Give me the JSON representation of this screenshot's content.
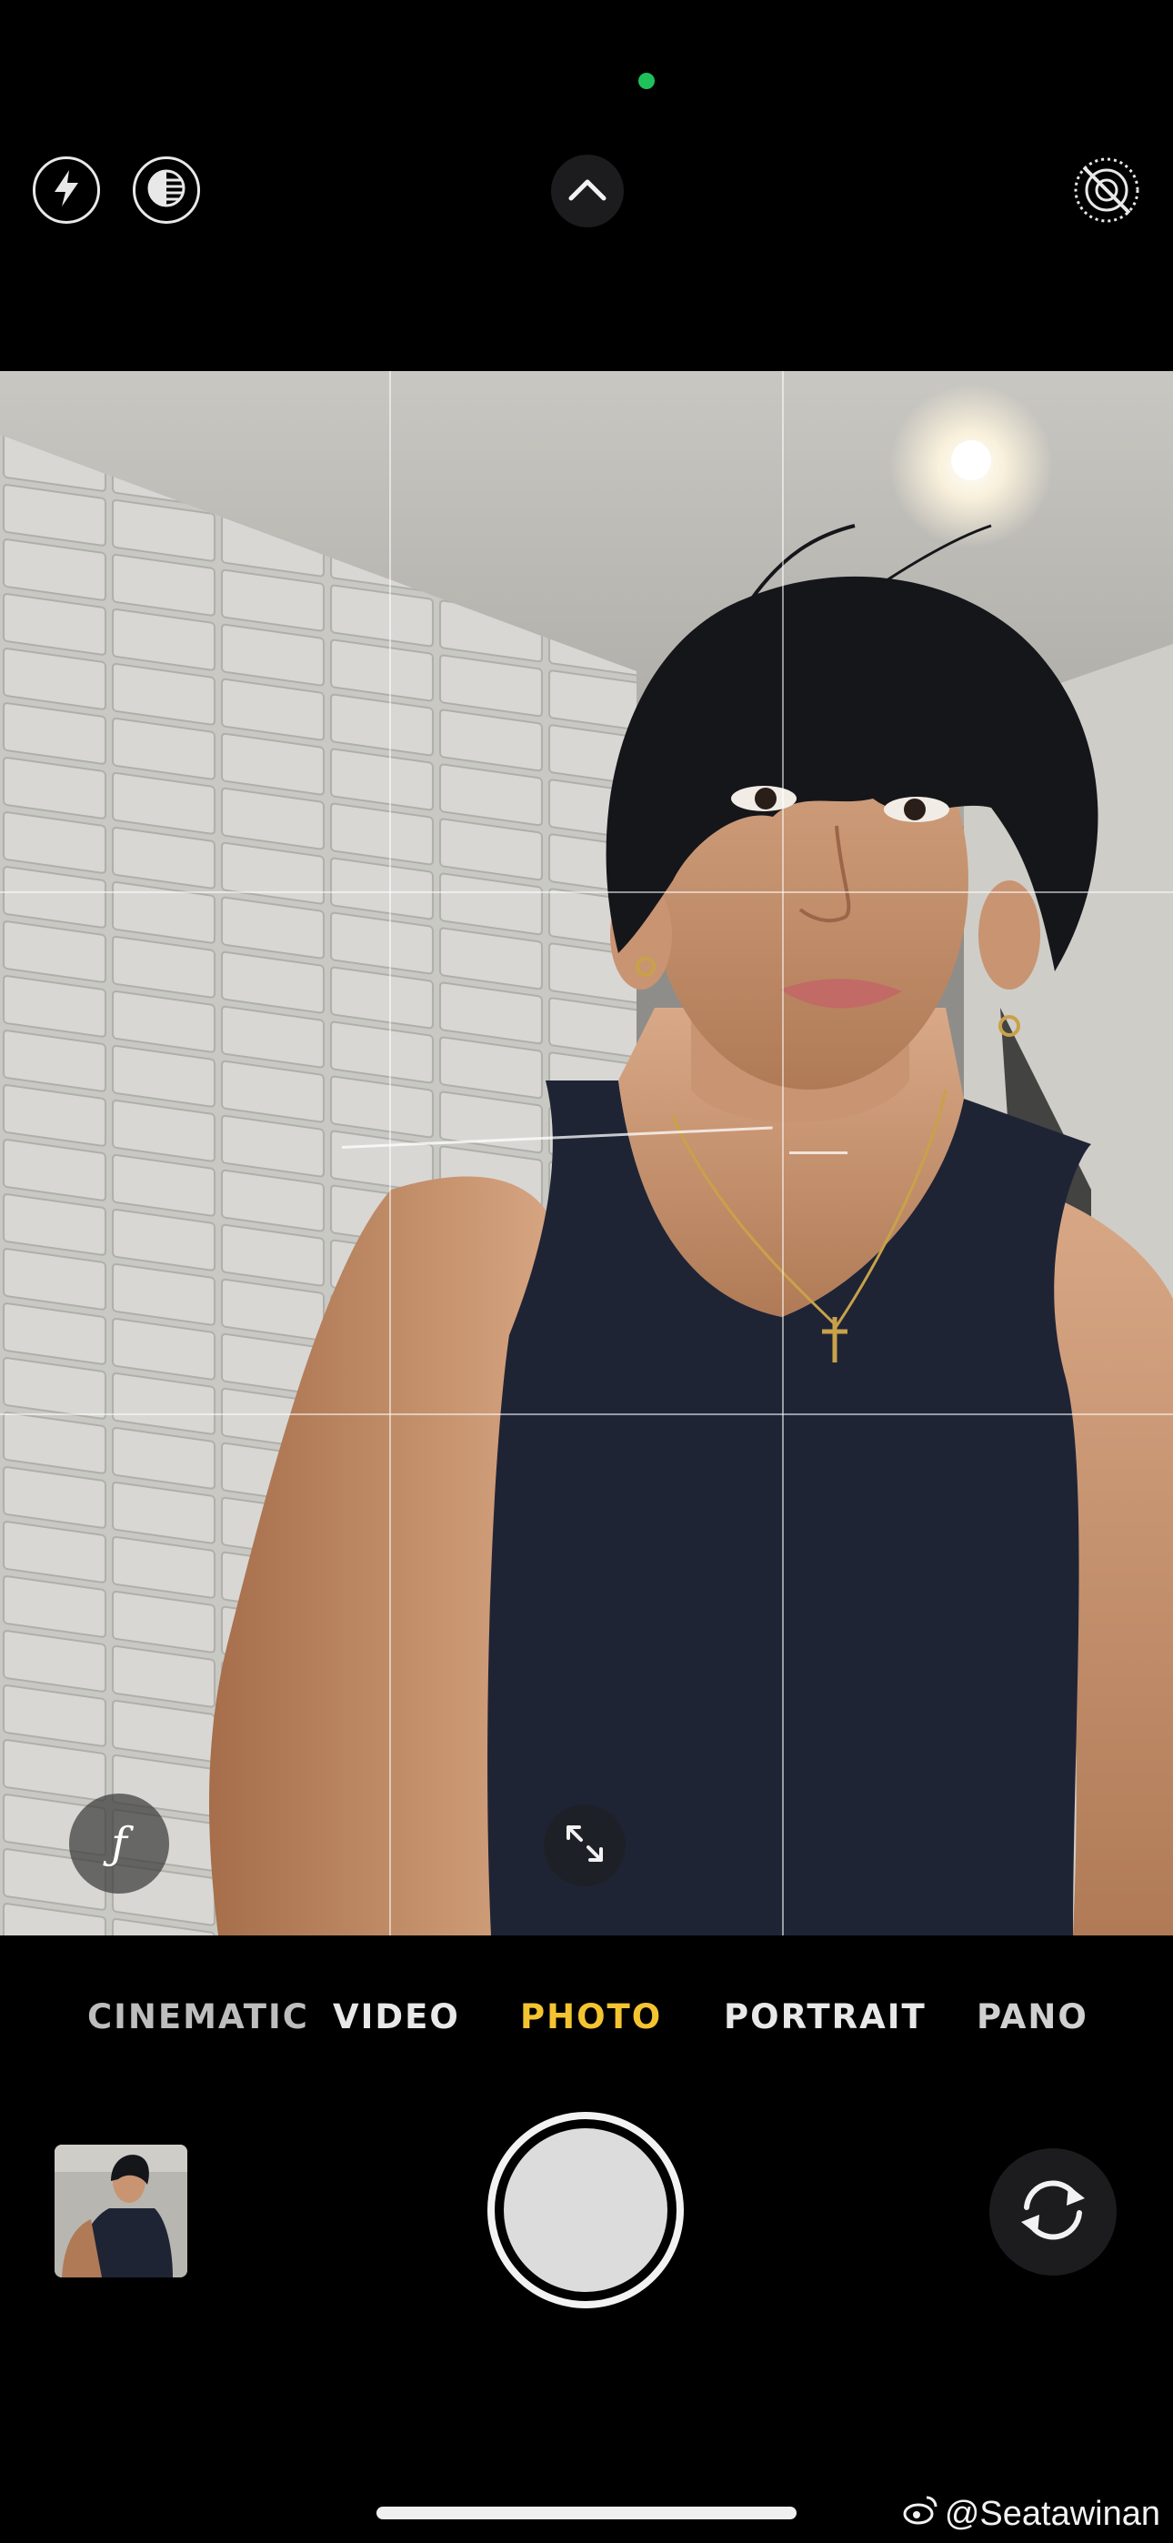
{
  "status": {
    "privacy_dot_color": "#1fc15b"
  },
  "top_bar": {
    "flash_icon": "flash-bolt-icon",
    "live_icon": "live-photo-icon",
    "chevron_icon": "chevron-up-icon",
    "live_off_icon": "live-photo-off-icon"
  },
  "viewfinder": {
    "grid": "3x3",
    "aperture_label": "ƒ",
    "expand_icon": "expand-arrows-icon"
  },
  "modes": [
    {
      "label": "CINEMATIC"
    },
    {
      "label": "VIDEO"
    },
    {
      "label": "PHOTO",
      "active": true
    },
    {
      "label": "PORTRAIT"
    },
    {
      "label": "PANO"
    }
  ],
  "controls": {
    "thumbnail_icon": "last-photo-thumbnail",
    "shutter_icon": "shutter-button",
    "flip_icon": "flip-camera-icon"
  },
  "colors": {
    "active_mode": "#f4c430",
    "inactive_mode": "#e8e8e8",
    "background": "#000000"
  },
  "watermark": {
    "text": "@Seatawinan",
    "icon": "weibo-logo-icon"
  }
}
